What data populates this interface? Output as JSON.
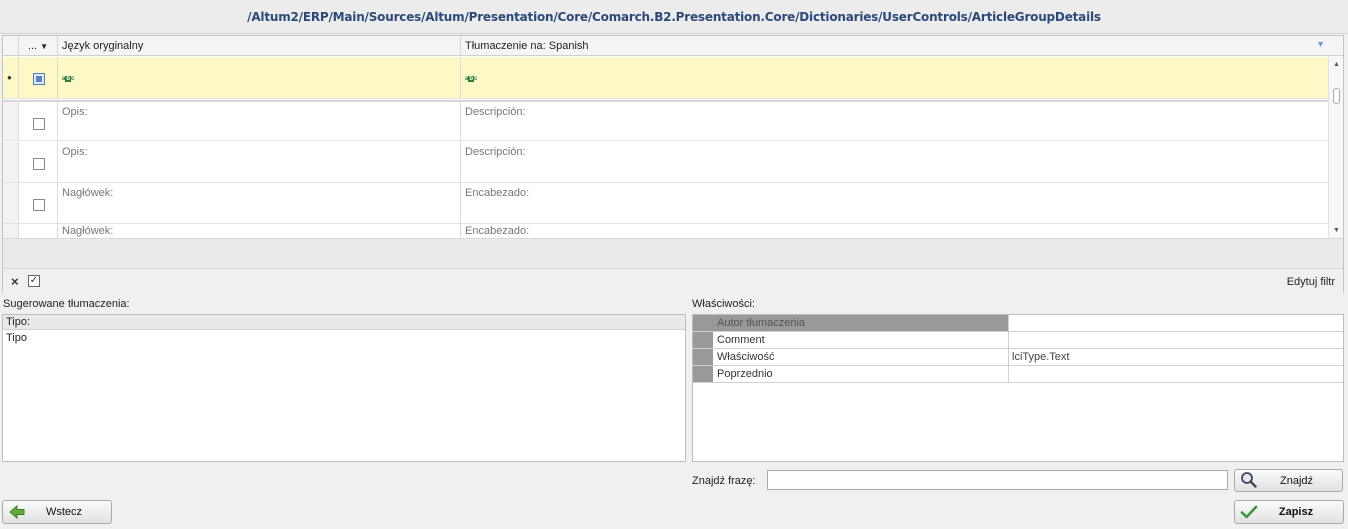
{
  "path_title": "/Altum2/ERP/Main/Sources/Altum/Presentation/Core/Comarch.B2.Presentation.Core/Dictionaries/UserControls/ArticleGroupDetails",
  "grid": {
    "col_menu": "...",
    "col_original": "Język oryginalny",
    "col_translation": "Tłumaczenie na: Spanish",
    "rows": [
      {
        "original": "Opis:",
        "translation": "Descripción:"
      },
      {
        "original": "Opis:",
        "translation": "Descripción:"
      },
      {
        "original": "Nagłówek:",
        "translation": "Encabezado:"
      },
      {
        "original": "Nagłówek:",
        "translation": "Encabezado:"
      }
    ],
    "edit_filter": "Edytuj filtr"
  },
  "suggested": {
    "label": "Sugerowane tłumaczenia:",
    "header": "Tipo:",
    "items": [
      "Tipo"
    ]
  },
  "properties": {
    "label": "Właściwości:",
    "rows": [
      {
        "name": "Autor tłumaczenia",
        "value": ""
      },
      {
        "name": "Comment",
        "value": ""
      },
      {
        "name": "Właściwość",
        "value": "lciType.Text"
      },
      {
        "name": "Poprzednio",
        "value": ""
      }
    ]
  },
  "find": {
    "label": "Znajdź frazę:",
    "value": "",
    "button": "Znajdź"
  },
  "buttons": {
    "back": "Wstecz",
    "save": "Zapisz"
  },
  "colors": {
    "filter_row": "#fcf9c6",
    "title_text": "#2b4a7a",
    "back_arrow": "#5fae3a",
    "save_check": "#3a9a3a"
  },
  "icons": {
    "back": "arrow-left-icon",
    "save": "checkmark-icon",
    "find": "magnifier-icon"
  }
}
